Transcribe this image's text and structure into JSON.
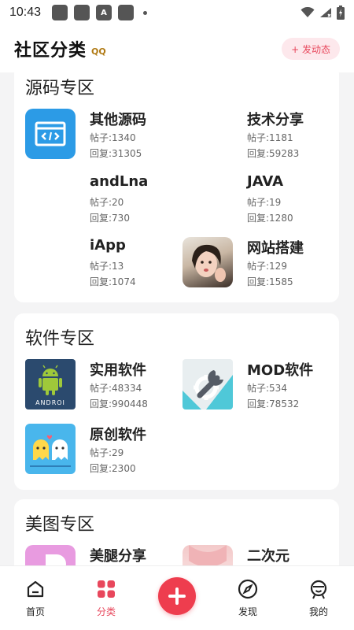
{
  "status_bar": {
    "time": "10:43"
  },
  "header": {
    "title": "社区分类",
    "badge": "QQ",
    "post_button": "+ 发动态"
  },
  "sections": [
    {
      "title": "源码专区",
      "items": [
        {
          "name": "其他源码",
          "posts": "帖子:1340",
          "replies": "回复:31305",
          "icon": "code-window-icon"
        },
        {
          "name": "技术分享",
          "posts": "帖子:1181",
          "replies": "回复:59283",
          "icon": ""
        },
        {
          "name": "andLna",
          "posts": "帖子:20",
          "replies": "回复:730",
          "icon": ""
        },
        {
          "name": "JAVA",
          "posts": "帖子:19",
          "replies": "回复:1280",
          "icon": ""
        },
        {
          "name": "iApp",
          "posts": "帖子:13",
          "replies": "回复:1074",
          "icon": ""
        },
        {
          "name": "网站搭建",
          "posts": "帖子:129",
          "replies": "回复:1585",
          "icon": "portrait-photo"
        }
      ]
    },
    {
      "title": "软件专区",
      "items": [
        {
          "name": "实用软件",
          "posts": "帖子:48334",
          "replies": "回复:990448",
          "icon": "android-robot-icon"
        },
        {
          "name": "MOD软件",
          "posts": "帖子:534",
          "replies": "回复:78532",
          "icon": "wrench-gear-icon"
        },
        {
          "name": "原创软件",
          "posts": "帖子:29",
          "replies": "回复:2300",
          "icon": "ghost-couple-icon"
        }
      ]
    },
    {
      "title": "美图专区",
      "items": [
        {
          "name": "美腿分享",
          "icon": "purple-logo-icon"
        },
        {
          "name": "二次元",
          "icon": "anime-photo"
        }
      ]
    }
  ],
  "bottom_nav": {
    "items": [
      {
        "label": "首页",
        "icon": "home-icon"
      },
      {
        "label": "分类",
        "icon": "category-icon"
      },
      {
        "label": "发现",
        "icon": "compass-icon"
      },
      {
        "label": "我的",
        "icon": "profile-icon"
      }
    ],
    "fab_icon": "plus-icon"
  },
  "colors": {
    "accent": "#ee3d4e",
    "accent_soft": "#fde8ec",
    "android_bg": "#2b4a6e",
    "android_green": "#9fc93a"
  }
}
